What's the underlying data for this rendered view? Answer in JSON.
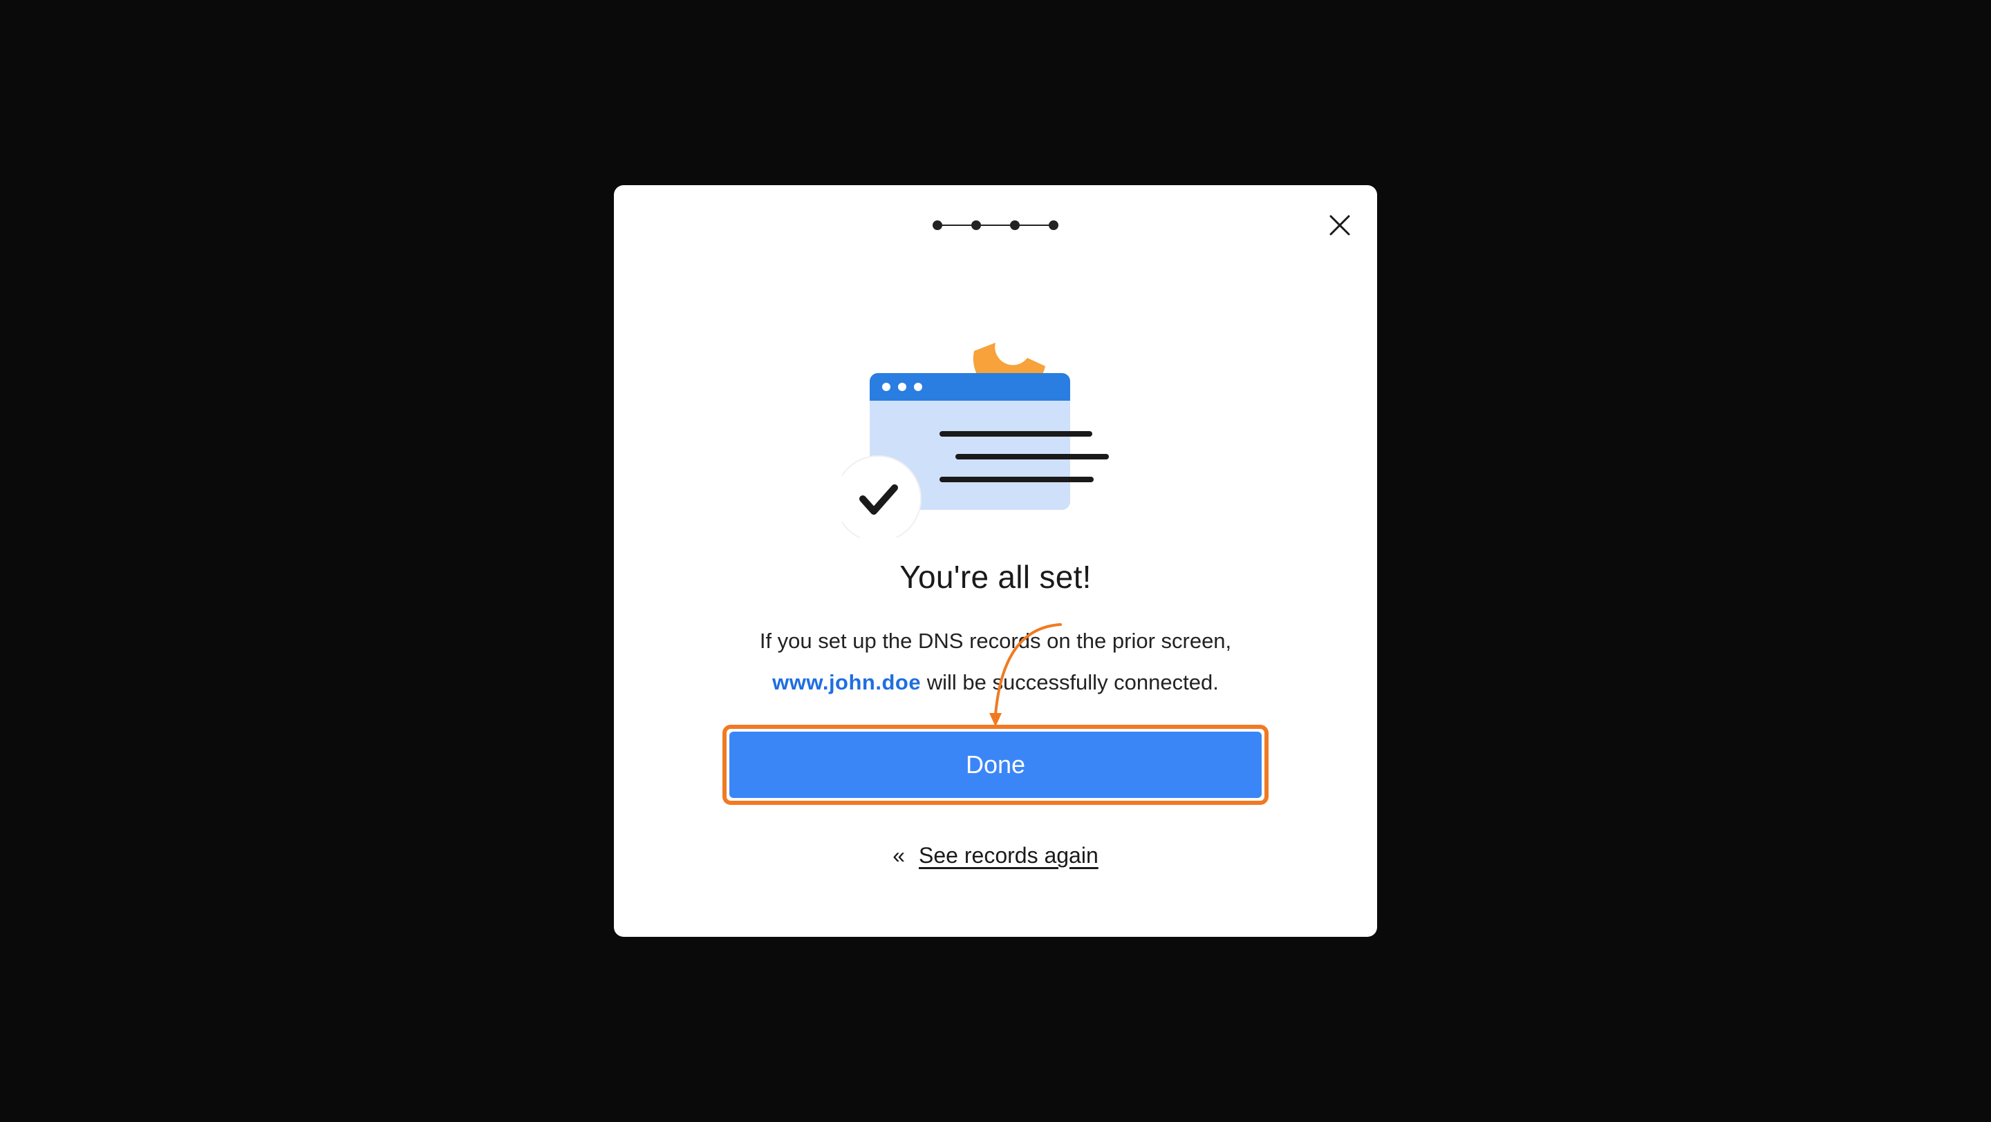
{
  "modal": {
    "stepper_count": 4,
    "title": "You're all set!",
    "description_line1": "If you set up the DNS records on the prior screen,",
    "domain": "www.john.doe",
    "description_line2_rest": " will be successfully connected.",
    "done_label": "Done",
    "see_records_label": "See records again",
    "see_records_chevron": "«"
  },
  "colors": {
    "backdrop": "#0a0a0a",
    "primary": "#3b86f7",
    "domain_link": "#1f6fe0",
    "highlight": "#f07a22",
    "illustration_blue": "#2a7de1",
    "illustration_light": "#cfe0fb",
    "illustration_orange": "#f7a23a"
  }
}
